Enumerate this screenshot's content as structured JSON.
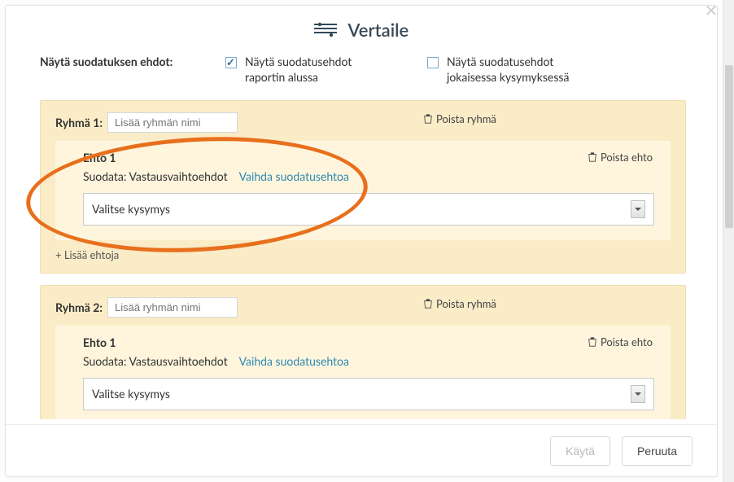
{
  "dialog": {
    "title": "Vertaile"
  },
  "filter_display": {
    "label": "Näytä suodatuksen ehdot:",
    "opt_report_start": "Näytä suodatusehdot raportin alussa",
    "opt_each_question": "Näytä suodatusehdot jokaisessa kysymyksessä"
  },
  "groups": [
    {
      "label": "Ryhmä 1:",
      "name_placeholder": "Lisää ryhmän nimi",
      "delete_label": "Poista ryhmä",
      "condition": {
        "title": "Ehto 1",
        "delete_label": "Poista ehto",
        "filter_prefix": "Suodata:",
        "filter_value": "Vastausvaihtoehdot",
        "change_link": "Vaihda suodatusehtoa",
        "select_placeholder": "Valitse kysymys"
      },
      "add_condition": "+ Lisää ehtoja"
    },
    {
      "label": "Ryhmä 2:",
      "name_placeholder": "Lisää ryhmän nimi",
      "delete_label": "Poista ryhmä",
      "condition": {
        "title": "Ehto 1",
        "delete_label": "Poista ehto",
        "filter_prefix": "Suodata:",
        "filter_value": "Vastausvaihtoehdot",
        "change_link": "Vaihda suodatusehtoa",
        "select_placeholder": "Valitse kysymys"
      }
    }
  ],
  "footer": {
    "apply": "Käytä",
    "cancel": "Peruuta"
  }
}
